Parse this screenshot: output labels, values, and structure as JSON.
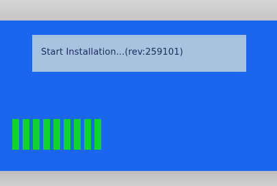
{
  "installer": {
    "status_text": "Start Installation...(rev:259101)",
    "progress": {
      "filled_segments": 9
    }
  },
  "colors": {
    "screen_background": "#1b66ef",
    "status_box": "#a7c3df",
    "progress_segment": "#10d42c",
    "bezel": "#c9c9c9"
  }
}
